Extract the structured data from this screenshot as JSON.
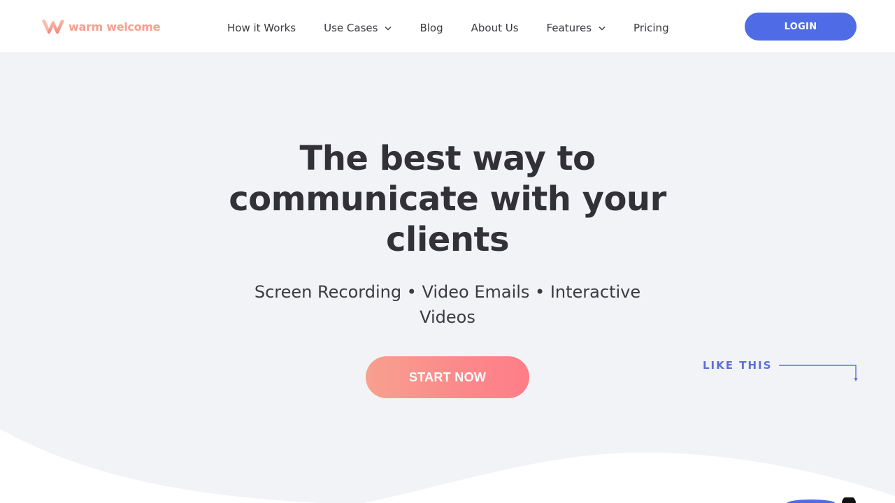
{
  "logo": {
    "text": "warm welcome",
    "icon": "warm-welcome-logo-icon",
    "color": "#f6a08e"
  },
  "nav": {
    "items": [
      {
        "label": "How it Works",
        "dropdown": false
      },
      {
        "label": "Use Cases",
        "dropdown": true
      },
      {
        "label": "Blog",
        "dropdown": false
      },
      {
        "label": "About Us",
        "dropdown": false
      },
      {
        "label": "Features",
        "dropdown": true
      },
      {
        "label": "Pricing",
        "dropdown": false
      }
    ]
  },
  "header": {
    "login_label": "LOGIN",
    "login_color": "#4f6ce6"
  },
  "hero": {
    "title": "The best way to communicate with your clients",
    "subtitle": "Screen Recording • Video Emails • Interactive Videos",
    "cta_label": "START NOW",
    "cta_gradient": [
      "#f8a08f",
      "#ff7d88"
    ],
    "like_this": "LIKE THIS",
    "accent_color": "#5a6fd8"
  },
  "colors": {
    "background": "#f2f3f7",
    "header_bg": "#ffffff",
    "text": "#333138"
  }
}
